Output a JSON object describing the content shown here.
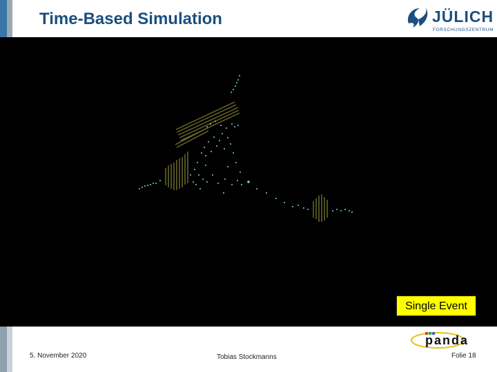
{
  "slide": {
    "title": "Time-Based Simulation",
    "event_label": "Single Event"
  },
  "header_logo": {
    "name": "JÜLICH",
    "subtitle": "FORSCHUNGSZENTRUM",
    "icon": "juelich-swoosh-icon",
    "color": "#1b4f7f"
  },
  "footer": {
    "date": "5. November 2020",
    "author": "Tobias Stockmanns",
    "slide_number": "Folie 18"
  },
  "footer_logo": {
    "name": "panda",
    "icon": "panda-logo"
  },
  "colors": {
    "accent_blue": "#1b4f7f",
    "viewport_background": "#000000",
    "label_background": "#ffff00",
    "hit_cyan": "#7fd0e0",
    "detector_olive": "#6b6a2a"
  }
}
